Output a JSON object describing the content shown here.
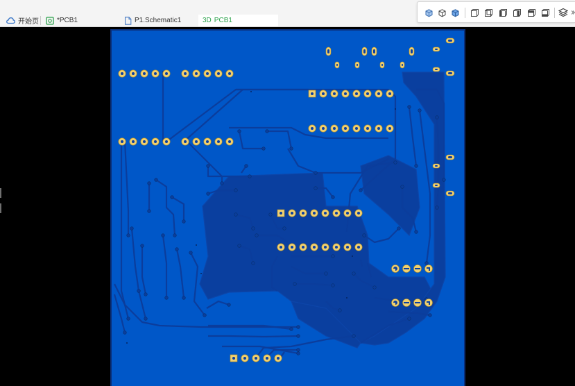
{
  "tabs": [
    {
      "label": "开始页",
      "icon": "home-cloud-icon",
      "active": false
    },
    {
      "label": "*PCB1",
      "icon": "pcb-icon",
      "active": false
    },
    {
      "label": "P1.Schematic1",
      "icon": "document-icon",
      "active": false
    },
    {
      "label": "PCB1",
      "prefix": "3D",
      "icon": "3d-view-icon",
      "active": true
    }
  ],
  "toolbar": {
    "buttons": [
      "view-cube-top-icon",
      "view-cube-bottom-icon",
      "view-cube-iso-icon",
      "view-front-icon",
      "view-back-icon",
      "view-left-icon",
      "view-right-icon",
      "view-top-icon",
      "view-bottom-icon",
      "layers-icon",
      "collapse-icon"
    ]
  },
  "board": {
    "substrate_color": "#0057c8",
    "pad_color": "#f0d070",
    "copper_color": "#0a3f9f",
    "headers": [
      "two 1x5 through-hole rows (top-left)",
      "two 1x5 through-hole rows (left)",
      "1x8 header row",
      "1x8 header row",
      "DIP-8x2 IC footprint",
      "two 1x4 pad rows (right)",
      "1x5 pad row (bottom)"
    ]
  }
}
